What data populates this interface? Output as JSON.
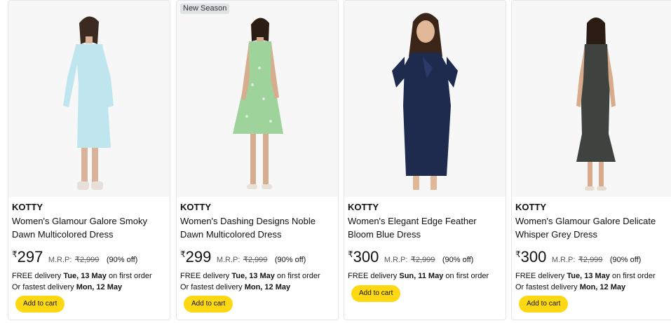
{
  "products": [
    {
      "badge": "",
      "brand": "KOTTY",
      "title": "Women's Glamour Galore Smoky Dawn Multicolored Dress",
      "currency": "₹",
      "price": "297",
      "mrp_label": "M.R.P:",
      "mrp": "₹2,999",
      "discount": "(90% off)",
      "delivery_prefix": "FREE delivery ",
      "delivery_date": "Tue, 13 May",
      "delivery_suffix": " on first order",
      "fastest_prefix": "Or fastest delivery ",
      "fastest_date": "Mon, 12 May",
      "button": "Add to cart",
      "dress_color": "#bfe6ee"
    },
    {
      "badge": "New Season",
      "brand": "KOTTY",
      "title": "Women's Dashing Designs Noble Dawn Multicolored Dress",
      "currency": "₹",
      "price": "299",
      "mrp_label": "M.R.P:",
      "mrp": "₹2,999",
      "discount": "(90% off)",
      "delivery_prefix": "FREE delivery ",
      "delivery_date": "Tue, 13 May",
      "delivery_suffix": " on first order",
      "fastest_prefix": "Or fastest delivery ",
      "fastest_date": "Mon, 12 May",
      "button": "Add to cart",
      "dress_color": "#9fd39c"
    },
    {
      "badge": "",
      "brand": "KOTTY",
      "title": "Women's Elegant Edge Feather Bloom Blue Dress",
      "currency": "₹",
      "price": "300",
      "mrp_label": "M.R.P:",
      "mrp": "₹2,999",
      "discount": "(90% off)",
      "delivery_prefix": "FREE delivery ",
      "delivery_date": "Sun, 11 May",
      "delivery_suffix": " on first order",
      "fastest_prefix": "",
      "fastest_date": "",
      "button": "Add to cart",
      "dress_color": "#1e2b4f"
    },
    {
      "badge": "",
      "brand": "KOTTY",
      "title": "Women's Glamour Galore Delicate Whisper Grey Dress",
      "currency": "₹",
      "price": "300",
      "mrp_label": "M.R.P:",
      "mrp": "₹2,999",
      "discount": "(90% off)",
      "delivery_prefix": "FREE delivery ",
      "delivery_date": "Tue, 13 May",
      "delivery_suffix": " on first order",
      "fastest_prefix": "Or fastest delivery ",
      "fastest_date": "Mon, 12 May",
      "button": "Add to cart",
      "dress_color": "#3f4340"
    }
  ]
}
